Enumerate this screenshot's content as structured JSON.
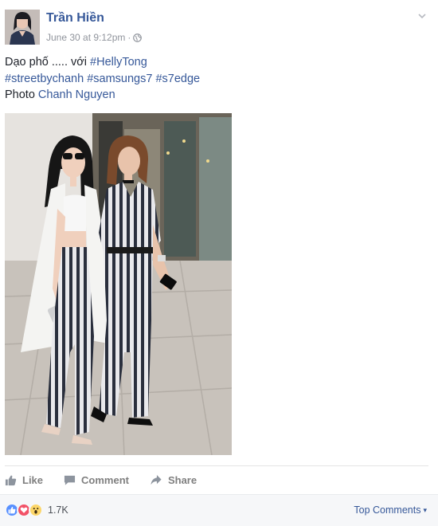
{
  "post": {
    "author": "Trần Hiền",
    "timestamp": "June 30 at 9:12pm",
    "separator": "·",
    "privacy_icon": "globe-icon",
    "text": {
      "line1_prefix": "Dạo phố ..... với ",
      "line1_tag": "#HellyTong",
      "tag_1": "#streetbychanh",
      "tag_2": "#samsungs7",
      "tag_3": "#s7edge",
      "line3_prefix": "Photo ",
      "line3_link": "Chanh Nguyen"
    }
  },
  "actions": {
    "like": "Like",
    "comment": "Comment",
    "share": "Share"
  },
  "footer": {
    "reaction_icons": [
      "like-icon",
      "love-icon",
      "wow-icon"
    ],
    "reaction_count": "1.7K",
    "top_comments": "Top Comments",
    "top_comments_caret": "▾"
  },
  "colors": {
    "link": "#365899",
    "muted": "#90949c",
    "action_grey": "#7f7f7f",
    "like_blue": "#5890ff",
    "love_red": "#f25268",
    "wow_yellow": "#fcd669"
  }
}
